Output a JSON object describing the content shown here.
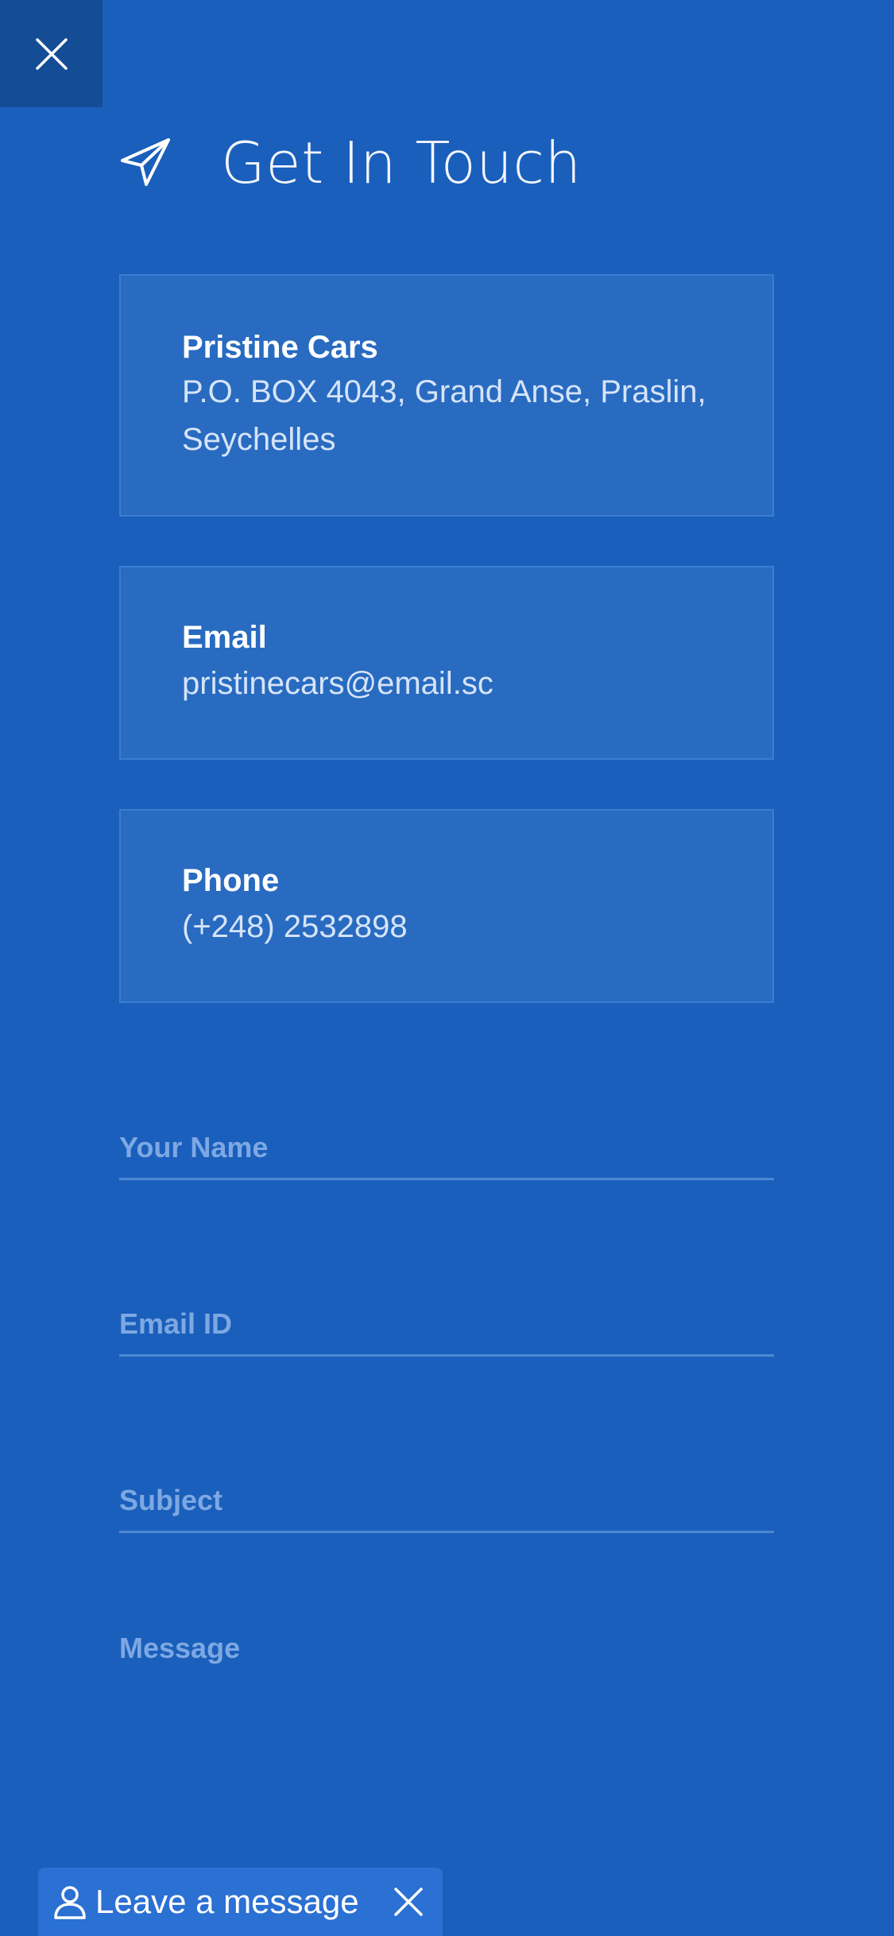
{
  "header": {
    "title": "Get In Touch",
    "close_icon": "close-icon",
    "title_icon": "paper-plane-icon"
  },
  "contact_cards": {
    "address": {
      "label": "Pristine Cars",
      "value": "P.O. BOX 4043, Grand Anse, Praslin, Seychelles"
    },
    "email": {
      "label": "Email",
      "value": "pristinecars@email.sc"
    },
    "phone": {
      "label": "Phone",
      "value": "(+248) 2532898"
    }
  },
  "form": {
    "name_placeholder": "Your Name",
    "name_value": "",
    "email_placeholder": "Email ID",
    "email_value": "",
    "subject_placeholder": "Subject",
    "subject_value": "",
    "message_placeholder": "Message",
    "message_value": ""
  },
  "chat_widget": {
    "label": "Leave a message",
    "person_icon": "person-icon",
    "close_icon": "close-icon"
  },
  "colors": {
    "background": "#1a5fbb",
    "close_box": "#154c96",
    "card": "#286bc1",
    "card_border": "#3b7dd0",
    "placeholder": "#7ea8e3",
    "chat_widget": "#2b70d3"
  }
}
